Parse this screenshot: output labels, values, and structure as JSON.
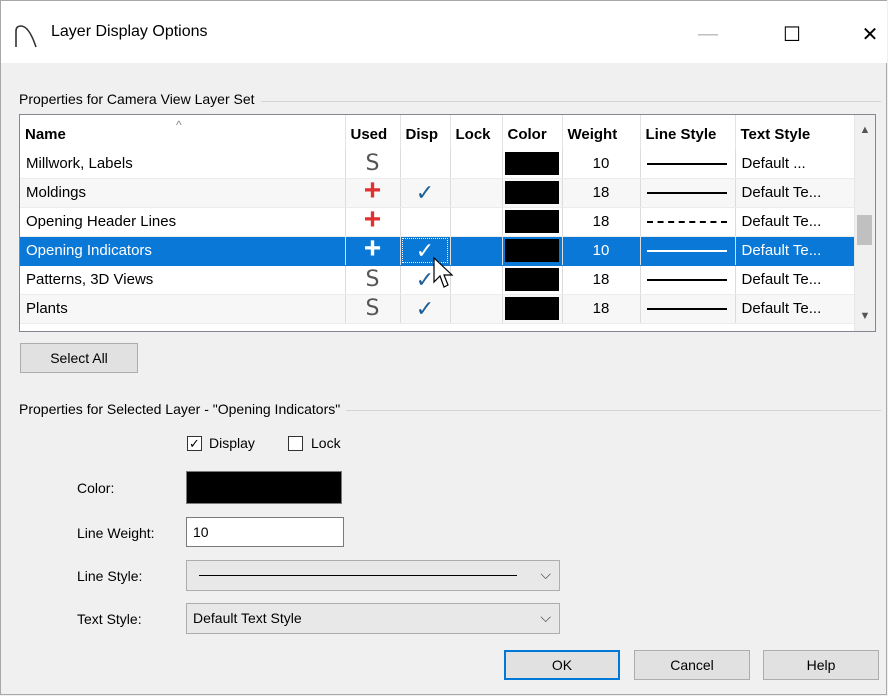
{
  "window": {
    "title": "Layer Display Options",
    "minimize_glyph": "—",
    "maximize_glyph": "☐",
    "close_glyph": "✕"
  },
  "table_group": {
    "label": "Properties for Camera View Layer Set",
    "columns": [
      "Name",
      "Used",
      "Disp",
      "Lock",
      "Color",
      "Weight",
      "Line Style",
      "Text Style"
    ],
    "rows": [
      {
        "name": "Millwork, Labels",
        "used": "S",
        "disp": "",
        "lock": "",
        "color": "#000000",
        "weight": "10",
        "line_style": "solid",
        "text_style": "Default ..."
      },
      {
        "name": "Moldings",
        "used": "+",
        "disp": "✓",
        "lock": "",
        "color": "#000000",
        "weight": "18",
        "line_style": "solid",
        "text_style": "Default Te..."
      },
      {
        "name": "Opening Header Lines",
        "used": "+",
        "disp": "",
        "lock": "",
        "color": "#000000",
        "weight": "18",
        "line_style": "dashed",
        "text_style": "Default Te..."
      },
      {
        "name": "Opening Indicators",
        "used": "+",
        "disp": "✓",
        "lock": "",
        "color": "#000000",
        "weight": "10",
        "line_style": "solid",
        "text_style": "Default Te...",
        "selected": true
      },
      {
        "name": "Patterns, 3D Views",
        "used": "S",
        "disp": "✓",
        "lock": "",
        "color": "#000000",
        "weight": "18",
        "line_style": "solid",
        "text_style": "Default Te..."
      },
      {
        "name": "Plants",
        "used": "S",
        "disp": "✓",
        "lock": "",
        "color": "#000000",
        "weight": "18",
        "line_style": "solid",
        "text_style": "Default Te..."
      }
    ],
    "select_all_label": "Select All"
  },
  "selected_group": {
    "label": "Properties for Selected Layer - \"Opening Indicators\"",
    "display_label": "Display",
    "display_checked": true,
    "lock_label": "Lock",
    "lock_checked": false,
    "color_label": "Color:",
    "color_value": "#000000",
    "line_weight_label": "Line Weight:",
    "line_weight_value": "10",
    "line_style_label": "Line Style:",
    "text_style_label": "Text Style:",
    "text_style_value": "Default Text Style"
  },
  "buttons": {
    "ok": "OK",
    "cancel": "Cancel",
    "help": "Help"
  },
  "colors": {
    "selection": "#0a78d7",
    "used_plus": "#e03030",
    "check": "#1b5e9a"
  }
}
